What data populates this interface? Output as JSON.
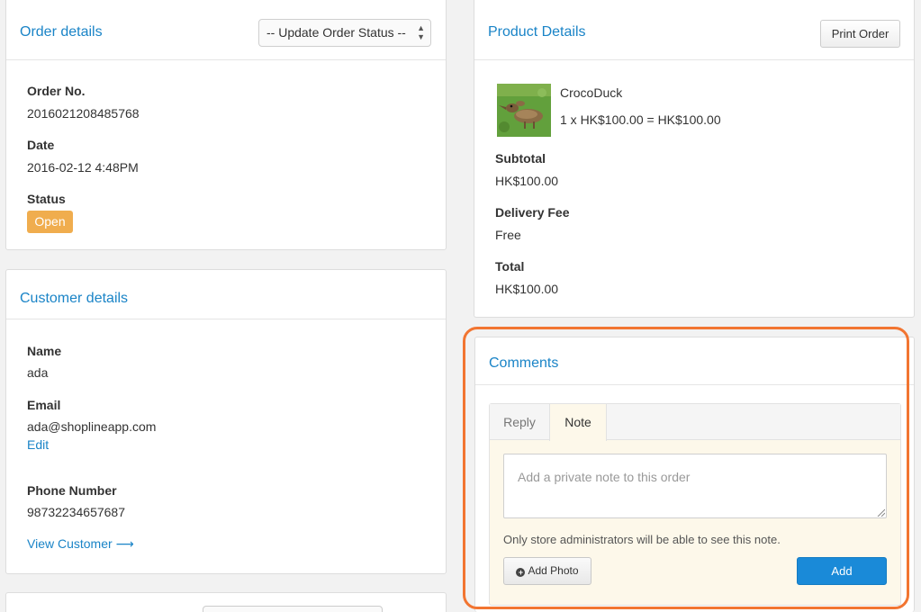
{
  "order": {
    "title": "Order details",
    "status_select": "-- Update Order Status --",
    "order_no_label": "Order No.",
    "order_no": "2016021208485768",
    "date_label": "Date",
    "date": "2016-02-12 4:48PM",
    "status_label": "Status",
    "status": "Open",
    "status_color": "#f0ad4e"
  },
  "customer": {
    "title": "Customer details",
    "name_label": "Name",
    "name": "ada",
    "email_label": "Email",
    "email": "ada@shoplineapp.com",
    "edit_link": "Edit",
    "phone_label": "Phone Number",
    "phone": "98732234657687",
    "view_link": "View Customer"
  },
  "product": {
    "title": "Product Details",
    "print_button": "Print Order",
    "item_name": "CrocoDuck",
    "item_line": "1 x HK$100.00 = HK$100.00",
    "subtotal_label": "Subtotal",
    "subtotal": "HK$100.00",
    "delivery_label": "Delivery Fee",
    "delivery": "Free",
    "total_label": "Total",
    "total": "HK$100.00"
  },
  "comments": {
    "title": "Comments",
    "tabs": [
      "Reply",
      "Note"
    ],
    "active_tab": "Note",
    "note_placeholder": "Add a private note to this order",
    "note_value": "",
    "hint": "Only store administrators will be able to see this note.",
    "add_photo": "Add Photo",
    "add_button": "Add",
    "highlight_color": "#f27531"
  },
  "colors": {
    "link": "#1a84c7",
    "primary_button": "#1a8ad8",
    "background": "#f2f2f2"
  }
}
